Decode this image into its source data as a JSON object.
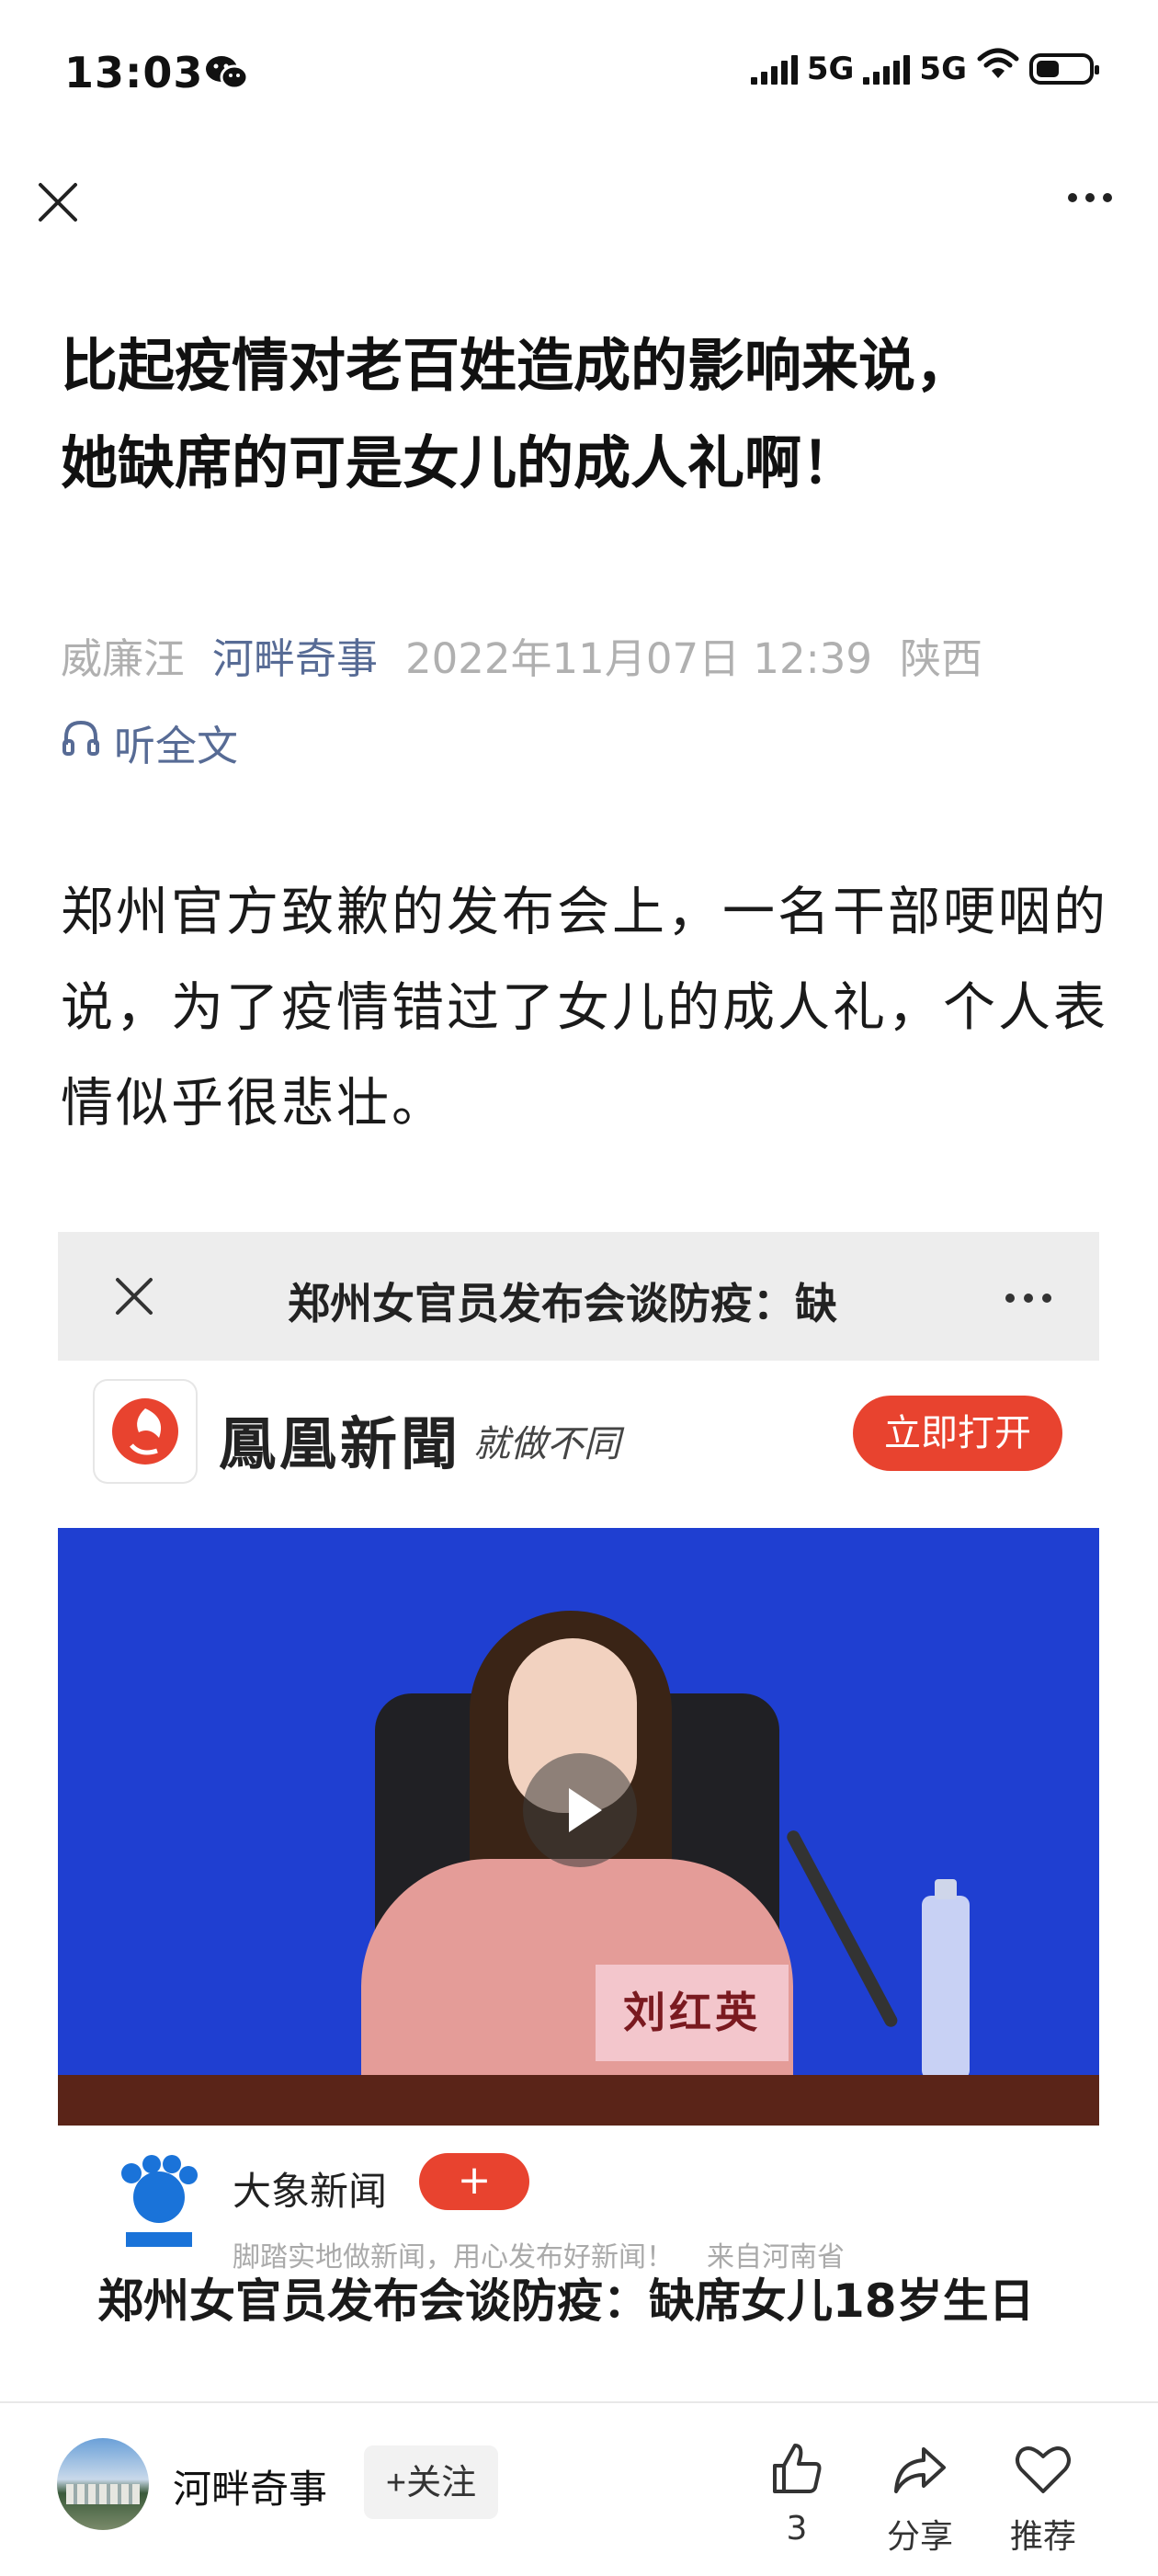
{
  "status_bar": {
    "time": "13:03",
    "network1": "5G",
    "network2": "5G",
    "battery_level": 0.45
  },
  "nav": {
    "close_icon": "close-icon",
    "more_icon": "more-icon"
  },
  "article": {
    "title": "比起疫情对老百姓造成的影响来说，她缺席的可是女儿的成人礼啊！",
    "author": "威廉汪",
    "account": "河畔奇事",
    "datetime": "2022年11月07日 12:39",
    "location": "陕西",
    "listen_label": "听全文",
    "body": "郑州官方致歉的发布会上，一名干部哽咽的说，为了疫情错过了女儿的成人礼，个人表情似乎很悲壮。"
  },
  "embed": {
    "top_title": "郑州女官员发布会谈防疫：缺",
    "ifeng_name": "鳳凰新聞",
    "ifeng_slogan": "就做不同",
    "open_button": "立即打开",
    "nameplate": "刘红英",
    "source_name": "大象新闻",
    "source_follow": "+",
    "source_tagline": "脚踏实地做新闻，用心发布好新闻！",
    "source_region": "来自河南省",
    "headline": "郑州女官员发布会谈防疫：缺席女儿18岁生日"
  },
  "bottom_bar": {
    "account_name": "河畔奇事",
    "follow_label": "+关注",
    "like_count": "3",
    "share_label": "分享",
    "recommend_label": "推荐"
  },
  "colors": {
    "link_blue": "#576b95",
    "accent_red": "#e8432f",
    "video_blue": "#1f3fd1"
  }
}
